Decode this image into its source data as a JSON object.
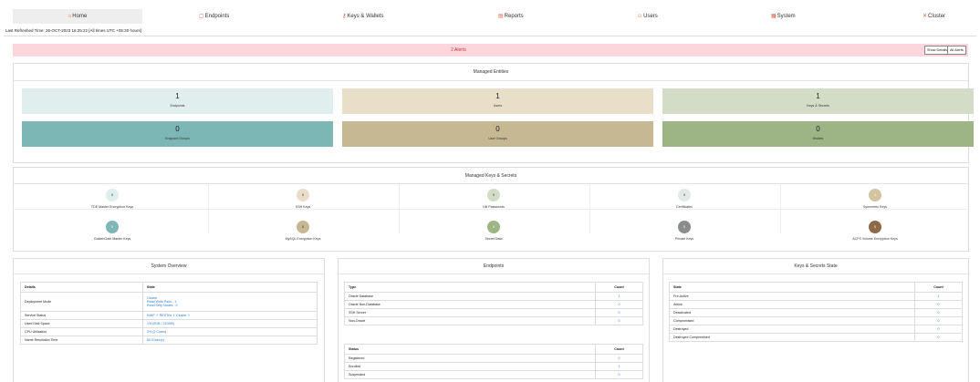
{
  "nav": {
    "items": [
      {
        "label": "Home",
        "icon": "home-icon"
      },
      {
        "label": "Endpoints",
        "icon": "endpoints-icon"
      },
      {
        "label": "Keys & Wallets",
        "icon": "keys-icon"
      },
      {
        "label": "Reports",
        "icon": "reports-icon"
      },
      {
        "label": "Users",
        "icon": "users-icon"
      },
      {
        "label": "System",
        "icon": "system-icon"
      },
      {
        "label": "Cluster",
        "icon": "cluster-icon"
      }
    ],
    "active": "Home"
  },
  "refreshed": "Last Refreshed Time: 26-OCT-2023 16:25:22 [All times UTC +05:30 hours]",
  "alerts": {
    "text": "2 Alerts",
    "show_details": "Show Details",
    "all_alerts": "All Alerts"
  },
  "managed_entities": {
    "title": "Managed Entities",
    "tiles": [
      {
        "value": "1",
        "label": "Endpoints",
        "color": "#e0eeee"
      },
      {
        "value": "1",
        "label": "Users",
        "color": "#e9dfc9"
      },
      {
        "value": "1",
        "label": "Keys & Secrets",
        "color": "#d2dcc6"
      },
      {
        "value": "0",
        "label": "Endpoint Groups",
        "color": "#7cb7b5"
      },
      {
        "value": "0",
        "label": "User Groups",
        "color": "#c7b894"
      },
      {
        "value": "0",
        "label": "Wallets",
        "color": "#9db484"
      }
    ]
  },
  "managed_keys": {
    "title": "Managed Keys & Secrets",
    "items": [
      {
        "value": "0",
        "label": "TDE Master Encryption Keys",
        "color": "#e0eeee"
      },
      {
        "value": "0",
        "label": "SSH Keys",
        "color": "#e9dfc9"
      },
      {
        "value": "0",
        "label": "DB Passwords",
        "color": "#d2dcc6"
      },
      {
        "value": "0",
        "label": "Certificates",
        "color": "#e3e9e6"
      },
      {
        "value": "1",
        "label": "Symmetric Keys",
        "color": "#d2c4a0"
      },
      {
        "value": "0",
        "label": "GoldenGate Master Keys",
        "color": "#7cb7b5"
      },
      {
        "value": "0",
        "label": "MySQL Encryption Keys",
        "color": "#c7b894"
      },
      {
        "value": "0",
        "label": "Secret Data",
        "color": "#9db484"
      },
      {
        "value": "0",
        "label": "Private Keys",
        "color": "#8a8c8c"
      },
      {
        "value": "0",
        "label": "ACFS Volume Encryption Keys",
        "color": "#8f6848"
      }
    ]
  },
  "system_overview": {
    "title": "System Overview",
    "headers": [
      "Details",
      "State"
    ],
    "rows": [
      {
        "label": "Deployment Mode",
        "lines": [
          "Cluster",
          "Read Write Pairs - 1",
          "Read Only Nodes - 0"
        ]
      },
      {
        "label": "Service Status",
        "services": [
          "KMIP",
          "RESTful",
          "Cluster"
        ]
      },
      {
        "label": "Used Disk Space",
        "value": "1% (5GB / 210GB)"
      },
      {
        "label": "CPU Utilization",
        "value": "2% (2 Cores)"
      },
      {
        "label": "Name Resolution Time",
        "value": "60.01sec(s)"
      }
    ]
  },
  "endpoints": {
    "title": "Endpoints",
    "type_headers": [
      "Type",
      "Count"
    ],
    "type_rows": [
      {
        "label": "Oracle Database",
        "count": "1"
      },
      {
        "label": "Oracle Non-Database",
        "count": "0"
      },
      {
        "label": "SSH Server",
        "count": "0"
      },
      {
        "label": "Non-Oracle",
        "count": "0"
      }
    ],
    "status_headers": [
      "Status",
      "Count"
    ],
    "status_rows": [
      {
        "label": "Registered",
        "count": "0"
      },
      {
        "label": "Enrolled",
        "count": "1"
      },
      {
        "label": "Suspended",
        "count": "0"
      }
    ]
  },
  "keys_state": {
    "title": "Keys & Secrets State",
    "headers": [
      "State",
      "Count"
    ],
    "rows": [
      {
        "label": "Pre-Active",
        "count": "1"
      },
      {
        "label": "Active",
        "count": "0"
      },
      {
        "label": "Deactivated",
        "count": "0"
      },
      {
        "label": "Compromised",
        "count": "0"
      },
      {
        "label": "Destroyed",
        "count": "0"
      },
      {
        "label": "Destroyed Compromised",
        "count": "0"
      }
    ]
  }
}
